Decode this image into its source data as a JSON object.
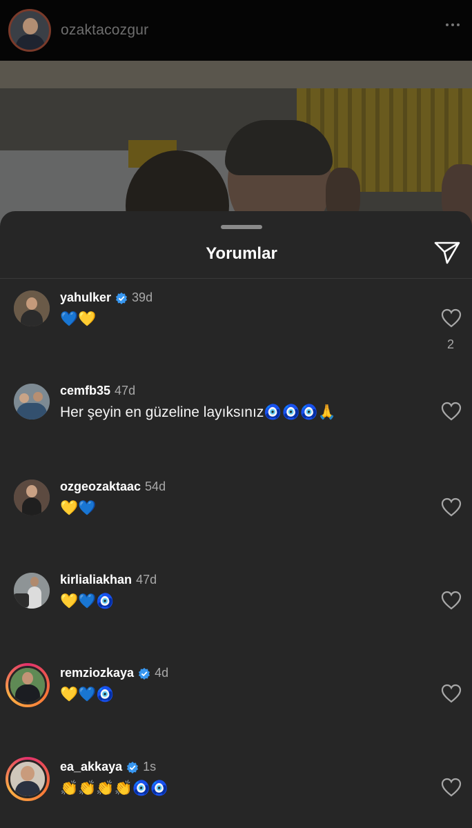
{
  "header": {
    "username": "ozaktacozgur",
    "avatar_icon": "profile-avatar",
    "more_icon": "more-horizontal-icon"
  },
  "sheet": {
    "title": "Yorumlar",
    "send_icon": "send-icon"
  },
  "comments": [
    {
      "username": "yahulker",
      "verified": true,
      "time": "39d",
      "text": "💙💛",
      "likes": "2"
    },
    {
      "username": "cemfb35",
      "verified": false,
      "time": "47d",
      "text": "Her şeyin en güzeline layıksınız🧿🧿🧿🙏",
      "likes": ""
    },
    {
      "username": "ozgeozaktaac",
      "verified": false,
      "time": "54d",
      "text": "💛💙",
      "likes": ""
    },
    {
      "username": "kirlialiakhan",
      "verified": false,
      "time": "47d",
      "text": "💛💙🧿",
      "likes": ""
    },
    {
      "username": "remziozkaya",
      "verified": true,
      "time": "4d",
      "text": "💛💙🧿",
      "likes": ""
    },
    {
      "username": "ea_akkaya",
      "verified": true,
      "time": "1s",
      "text": "👏👏👏👏🧿🧿",
      "likes": ""
    }
  ],
  "colors": {
    "sheet_bg": "#262626",
    "verified_blue": "#3897f0",
    "muted_text": "#a8a8a8"
  }
}
